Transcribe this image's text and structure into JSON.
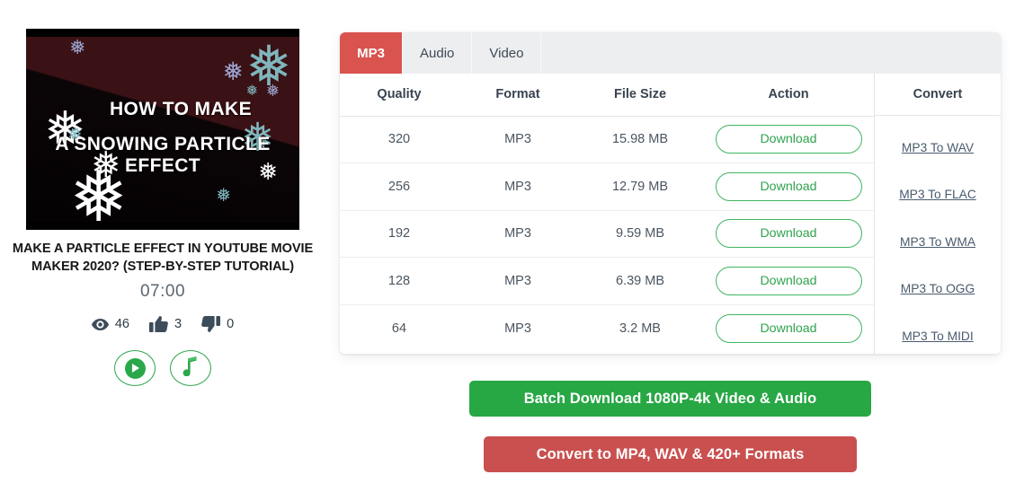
{
  "video": {
    "thumbnail": {
      "line1": "HOW TO MAKE",
      "line2": "A SNOWING PARTICLE EFFECT",
      "snowflake_glyph": "❅",
      "bg_dark": "#000000",
      "bg_maroon": "#3a1114"
    },
    "title": "MAKE A PARTICLE EFFECT IN YOUTUBE MOVIE MAKER 2020? (STEP-BY-STEP TUTORIAL)",
    "duration": "07:00",
    "stats": [
      {
        "icon": "eye-icon",
        "value": "46"
      },
      {
        "icon": "thumbs-up-icon",
        "value": "3"
      },
      {
        "icon": "thumbs-down-icon",
        "value": "0"
      }
    ],
    "actions": [
      {
        "icon": "play-icon",
        "name": "play-button"
      },
      {
        "icon": "music-note-icon",
        "name": "music-button"
      }
    ]
  },
  "panel": {
    "tabs": [
      {
        "label": "MP3",
        "active": true
      },
      {
        "label": "Audio",
        "active": false
      },
      {
        "label": "Video",
        "active": false
      }
    ],
    "table": {
      "headers": [
        "Quality",
        "Format",
        "File Size",
        "Action"
      ],
      "rows": [
        {
          "quality": "320",
          "format": "MP3",
          "size": "15.98 MB",
          "action": "Download"
        },
        {
          "quality": "256",
          "format": "MP3",
          "size": "12.79 MB",
          "action": "Download"
        },
        {
          "quality": "192",
          "format": "MP3",
          "size": "9.59 MB",
          "action": "Download"
        },
        {
          "quality": "128",
          "format": "MP3",
          "size": "6.39 MB",
          "action": "Download"
        },
        {
          "quality": "64",
          "format": "MP3",
          "size": "3.2 MB",
          "action": "Download"
        }
      ]
    },
    "convert": {
      "header": "Convert",
      "links": [
        "MP3 To WAV",
        "MP3 To FLAC",
        "MP3 To WMA",
        "MP3 To OGG",
        "MP3 To MIDI"
      ]
    }
  },
  "cta": {
    "batch": "Batch Download 1080P-4k Video & Audio",
    "convert": "Convert to MP4, WAV & 420+ Formats"
  },
  "colors": {
    "tab_active": "#d9534f",
    "download_green": "#3fb560",
    "cta_green": "#28a745",
    "cta_red": "#c9504f",
    "link": "#4a5b6e"
  }
}
